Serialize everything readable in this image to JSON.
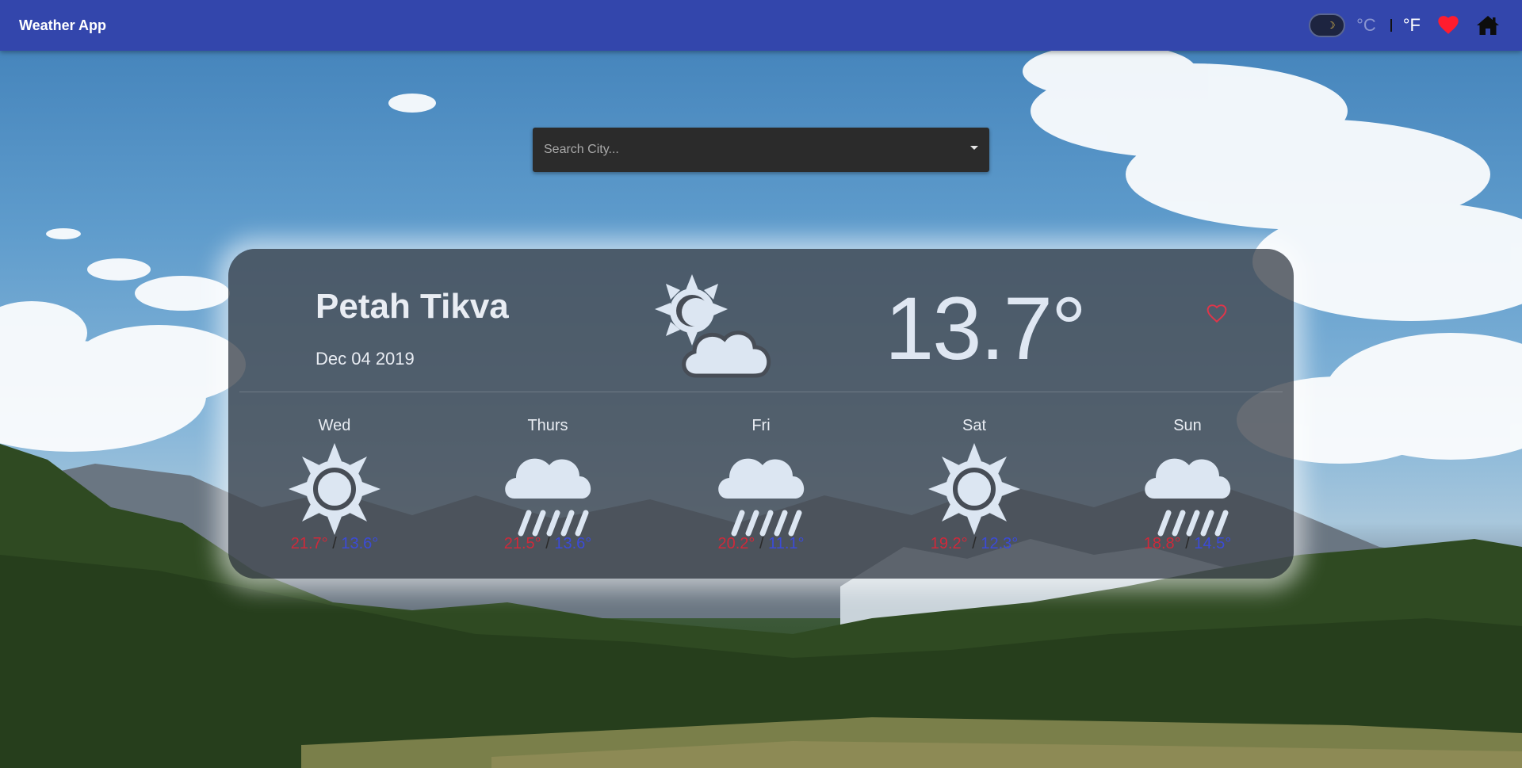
{
  "app": {
    "title": "Weather App"
  },
  "toolbar": {
    "celsius_label": "°C",
    "fahrenheit_label": "°F",
    "theme_icon": "moon-icon",
    "favorites_icon": "heart-icon",
    "home_icon": "home-icon",
    "colors": {
      "bar": "#3346ac",
      "heart": "#ff1c2e"
    }
  },
  "search": {
    "placeholder": "Search City..."
  },
  "current": {
    "city": "Petah Tikva",
    "date": "Dec 04 2019",
    "temperature": "13.7°",
    "icon": "partly-cloudy-icon",
    "favorite_icon": "heart-outline-icon"
  },
  "forecast": [
    {
      "day": "Wed",
      "icon": "sun-icon",
      "high": "21.7°",
      "low": "13.6°"
    },
    {
      "day": "Thurs",
      "icon": "rain-icon",
      "high": "21.5°",
      "low": "13.6°"
    },
    {
      "day": "Fri",
      "icon": "rain-icon",
      "high": "20.2°",
      "low": "11.1°"
    },
    {
      "day": "Sat",
      "icon": "sun-icon",
      "high": "19.2°",
      "low": "12.3°"
    },
    {
      "day": "Sun",
      "icon": "rain-icon",
      "high": "18.8°",
      "low": "14.5°"
    }
  ],
  "range_separator": " / "
}
